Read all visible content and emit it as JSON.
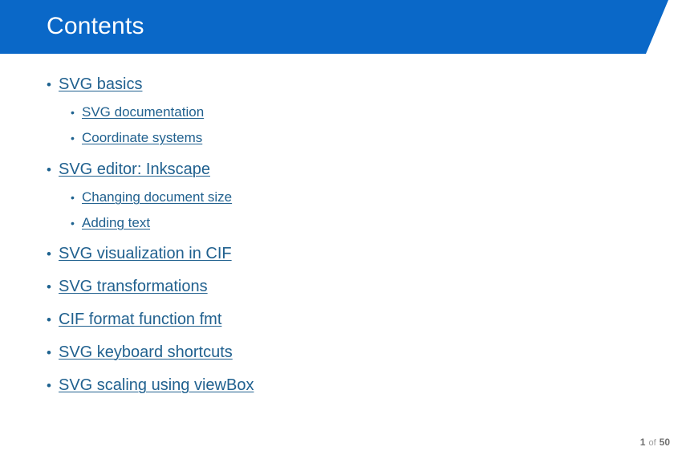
{
  "slide": {
    "title": "Contents",
    "header_color": "#0a68c8",
    "title_color": "#ffffff",
    "link_color": "#21618f",
    "background_color": "#ffffff"
  },
  "toc": {
    "items": [
      {
        "level": 1,
        "bullet": "•",
        "label": "SVG basics"
      },
      {
        "level": 2,
        "bullet": "•",
        "label": "SVG documentation"
      },
      {
        "level": 2,
        "bullet": "•",
        "label": "Coordinate systems"
      },
      {
        "level": 1,
        "bullet": "•",
        "label": "SVG editor: Inkscape"
      },
      {
        "level": 2,
        "bullet": "•",
        "label": "Changing document size"
      },
      {
        "level": 2,
        "bullet": "•",
        "label": "Adding text"
      },
      {
        "level": 1,
        "bullet": "•",
        "label": "SVG visualization in CIF"
      },
      {
        "level": 1,
        "bullet": "•",
        "label": "SVG transformations"
      },
      {
        "level": 1,
        "bullet": "•",
        "label": "CIF format function fmt"
      },
      {
        "level": 1,
        "bullet": "•",
        "label": "SVG keyboard shortcuts"
      },
      {
        "level": 1,
        "bullet": "•",
        "label": "SVG scaling using viewBox"
      }
    ]
  },
  "footer": {
    "current_page": "1",
    "separator": "of",
    "total_pages": "50"
  }
}
